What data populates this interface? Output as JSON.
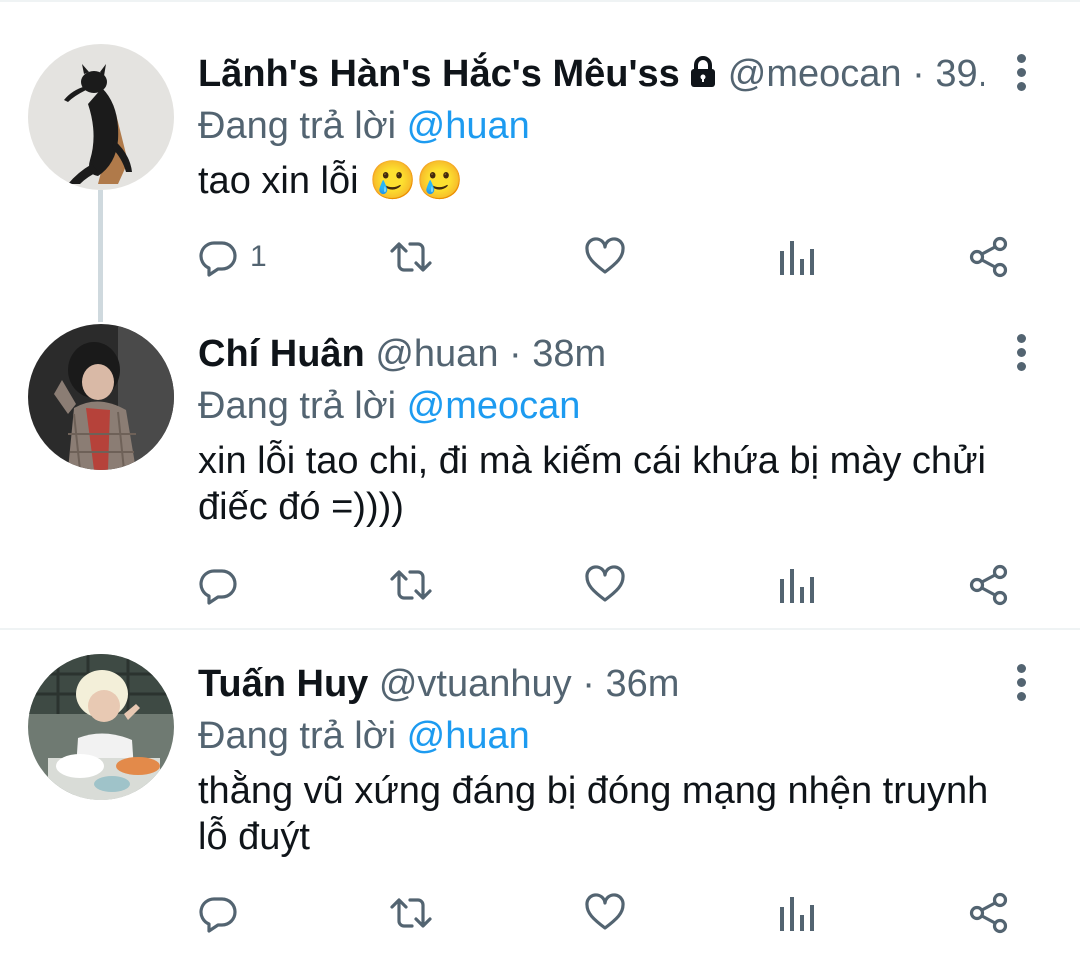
{
  "tweets": [
    {
      "name": "Lãnh's Hàn's Hắc's Mêu'ss",
      "protected": true,
      "handle": "@meocan",
      "separator": "·",
      "time": "39...",
      "replying_prefix": "Đang trả lời",
      "replying_to": "@huan",
      "text": "tao xin lỗi 🥲🥲",
      "reply_count": "1",
      "avatar": "black-cat-avatar"
    },
    {
      "name": "Chí Huân",
      "handle": "@huan",
      "separator": "·",
      "time": "38m",
      "replying_prefix": "Đang trả lời",
      "replying_to": "@meocan",
      "text": "xin lỗi tao chi, đi mà kiếm cái khứa bị mày chửi điếc đó =))))",
      "reply_count": "",
      "avatar": "person-plaid-avatar"
    },
    {
      "name": "Tuấn Huy",
      "handle": "@vtuanhuy",
      "separator": "·",
      "time": "36m",
      "replying_prefix": "Đang trả lời",
      "replying_to": "@huan",
      "text": "thằng vũ xứng đáng bị đóng mạng nhện truynh lỗ đuýt",
      "reply_count": "",
      "avatar": "blond-person-eating-avatar"
    }
  ],
  "icons": [
    "reply-icon",
    "retweet-icon",
    "like-icon",
    "analytics-icon",
    "share-icon",
    "more-icon",
    "lock-icon"
  ],
  "colors": {
    "mention": "#1d9bf0",
    "secondary_text": "#536471",
    "thread_line": "#cfd9de"
  }
}
